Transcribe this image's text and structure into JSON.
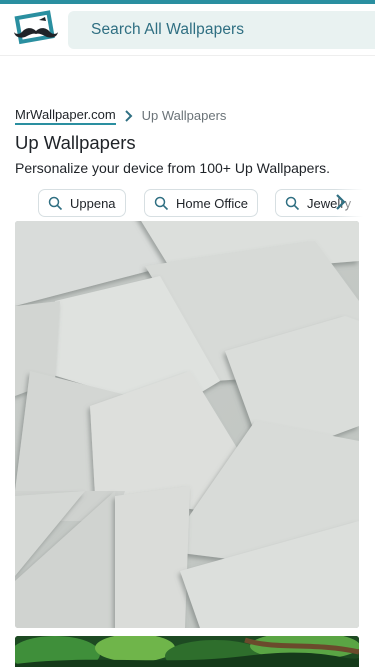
{
  "header": {
    "search_placeholder": "Search All Wallpapers",
    "logo_icon": "mustache-frame-logo-icon",
    "brand_color": "#2a8fa0"
  },
  "breadcrumb": {
    "home": "MrWallpaper.com",
    "separator_icon": "chevron-right-icon",
    "current": "Up Wallpapers"
  },
  "page": {
    "title": "Up Wallpapers",
    "subtitle": "Personalize your device from 100+ Up Wallpapers."
  },
  "chips": [
    {
      "label": "Uppena",
      "icon": "search-icon"
    },
    {
      "label": "Home Office",
      "icon": "search-icon"
    },
    {
      "label": "Jewelry",
      "icon": "search-icon"
    }
  ],
  "chips_next_icon": "chevron-right-icon",
  "wallpapers": [
    {
      "subject": "paper-sheets",
      "colors": [
        "#d4d8d5",
        "#9ea49f"
      ]
    },
    {
      "subject": "green-forest",
      "colors": [
        "#1a4020",
        "#6fb54a"
      ]
    }
  ]
}
